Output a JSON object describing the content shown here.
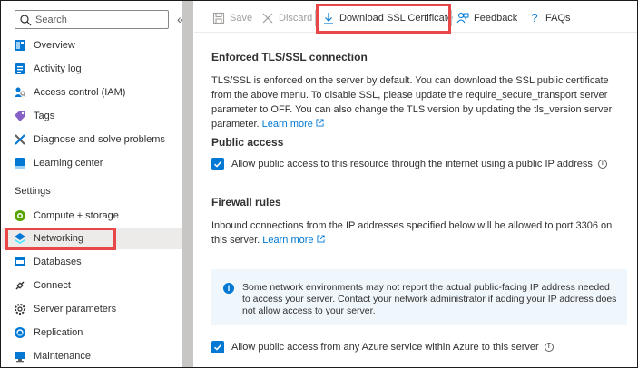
{
  "sidebar": {
    "search_placeholder": "Search",
    "collapse_glyph": "«",
    "items_top": [
      {
        "label": "Overview",
        "icon": "overview-icon"
      },
      {
        "label": "Activity log",
        "icon": "activity-log-icon"
      },
      {
        "label": "Access control (IAM)",
        "icon": "iam-icon"
      },
      {
        "label": "Tags",
        "icon": "tag-icon"
      },
      {
        "label": "Diagnose and solve problems",
        "icon": "diagnose-icon"
      },
      {
        "label": "Learning center",
        "icon": "learning-center-icon"
      }
    ],
    "settings_heading": "Settings",
    "items_settings": [
      {
        "label": "Compute + storage",
        "icon": "compute-icon"
      },
      {
        "label": "Networking",
        "icon": "networking-icon",
        "selected": true
      },
      {
        "label": "Databases",
        "icon": "database-icon"
      },
      {
        "label": "Connect",
        "icon": "connect-icon"
      },
      {
        "label": "Server parameters",
        "icon": "gear-icon"
      },
      {
        "label": "Replication",
        "icon": "replication-icon"
      },
      {
        "label": "Maintenance",
        "icon": "maintenance-icon"
      }
    ]
  },
  "toolbar": {
    "save_label": "Save",
    "discard_label": "Discard",
    "download_label": "Download SSL Certificate",
    "feedback_label": "Feedback",
    "faqs_label": "FAQs"
  },
  "content": {
    "tls_heading": "Enforced TLS/SSL connection",
    "tls_text": "TLS/SSL is enforced on the server by default. You can download the SSL public certificate from the above menu. To disable SSL, please update the require_secure_transport server parameter to OFF. You can also change the TLS version by updating the tls_version server parameter.",
    "learn_more": "Learn more",
    "public_access_heading": "Public access",
    "public_access_checkbox": "Allow public access to this resource through the internet using a public IP address",
    "firewall_heading": "Firewall rules",
    "firewall_text": "Inbound connections from the IP addresses specified below will be allowed to port 3306 on this server.",
    "info_text": "Some network environments may not report the actual public-facing IP address needed to access your server.  Contact your network administrator if adding your IP address does not allow access to your server.",
    "azure_checkbox": "Allow public access from any Azure service within Azure to this server"
  },
  "colors": {
    "accent": "#0078d4",
    "highlight": "#e8474a",
    "selected_bg": "#edebe9",
    "info_bg": "#eff6fc"
  }
}
